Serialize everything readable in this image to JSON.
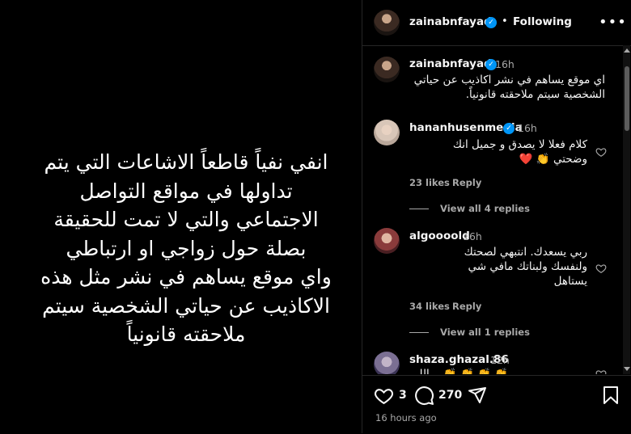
{
  "media": {
    "lines": [
      "انفي نفياً قاطعاً الاشاعات التي يتم",
      "تداولها في مواقع التواصل",
      "الاجتماعي والتي لا تمت للحقيقة",
      "بصلة حول زواجي او ارتباطي",
      "واي موقع يساهم في نشر مثل هذه",
      "الاكاذيب عن حياتي الشخصية سيتم",
      "ملاحقته قانونياً"
    ]
  },
  "header": {
    "username": "zainabnfayad",
    "dot": "•",
    "follow_status": "Following",
    "more": "•••"
  },
  "caption": {
    "username": "zainabnfayad",
    "time": "16h",
    "line1": "اي موقع يساهم في نشر اكاذيب عن حياتي",
    "line2": "الشخصية سيتم ملاحقته قانونياً."
  },
  "comments": [
    {
      "username": "hananhusenmedia",
      "time": "16h",
      "line1": "كلام فعلا لا يصدق و جميل انك",
      "line2": "وضحتي 👏 ❤️",
      "likes": "23 likes",
      "reply": "Reply",
      "view_replies": "View all 4 replies"
    },
    {
      "username": "algoooold",
      "time": "16h",
      "line1": "ربي يسعدك. انتبهي لصحتك",
      "line2": "ولنفسك ولبناتك مافي شي",
      "line3": "يستاهل",
      "likes": "34 likes",
      "reply": "Reply",
      "view_replies": "View all 1 replies"
    },
    {
      "username": "shaza.ghazal.86",
      "time": "12h",
      "line1": "👏 👏 👏 👏 ...اللي"
    }
  ],
  "actions": {
    "likes_count": "3",
    "comments_count": "270",
    "posted": "16 hours ago"
  },
  "icons": {
    "header_more": "more-horizontal-icon",
    "like": "heart-icon",
    "comment": "comment-bubble-icon",
    "share": "paper-plane-icon",
    "save": "bookmark-icon",
    "verified": "verified-badge-icon"
  },
  "colors": {
    "background": "#000000",
    "verified": "#0095f6",
    "secondary_text": "#a8a8a8"
  }
}
